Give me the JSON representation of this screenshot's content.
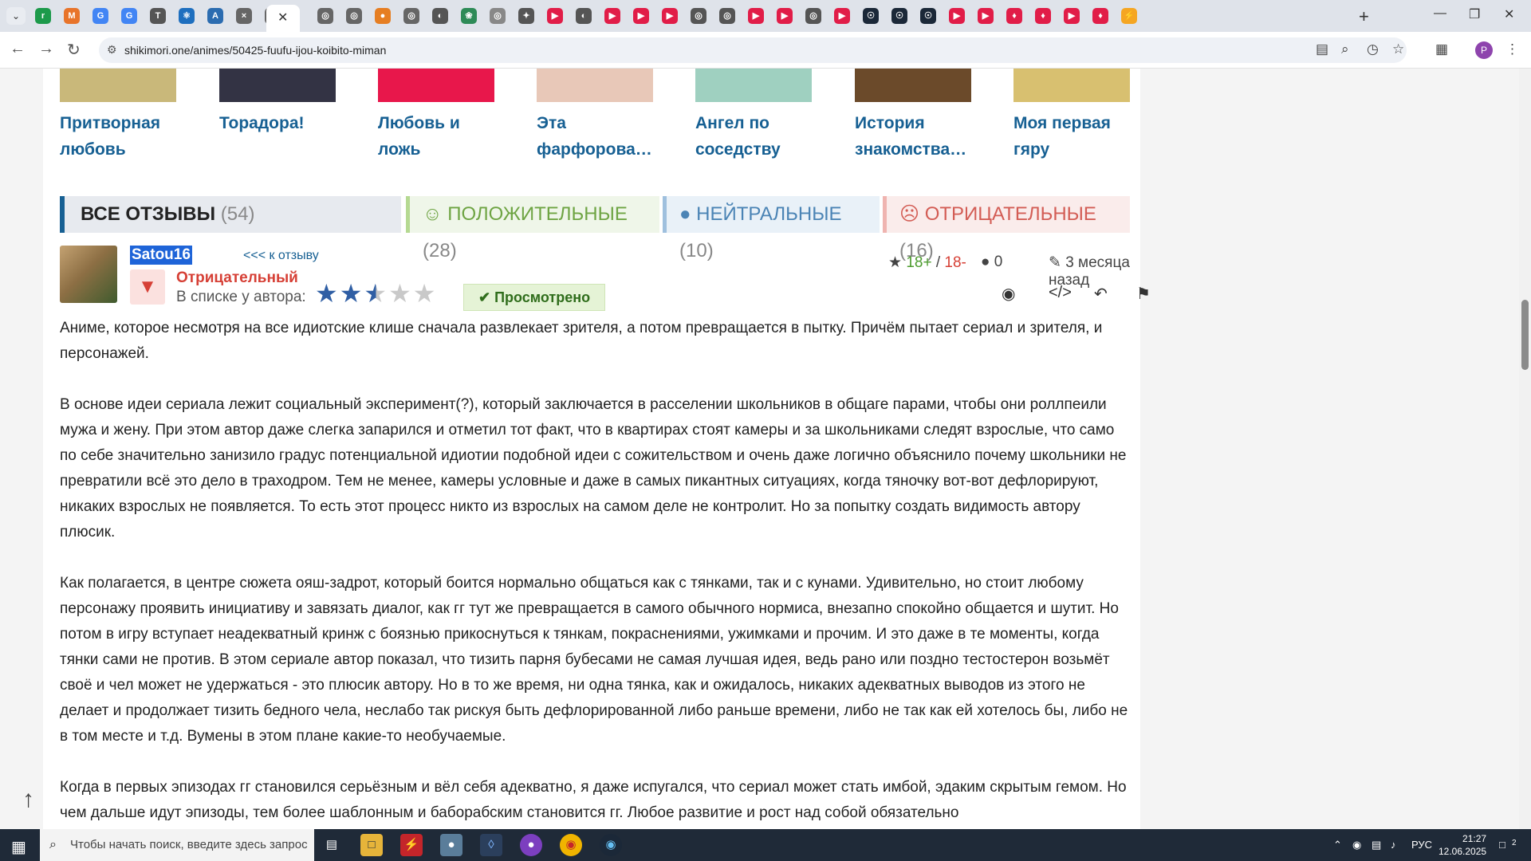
{
  "browser": {
    "tab_favicons": [
      "r",
      "M",
      "G",
      "G",
      "T",
      "⚛",
      "A",
      "×",
      "◎",
      "◎",
      "◎",
      "●",
      "◎",
      "◐",
      "❀",
      "◎",
      "✦",
      "▶",
      "◐",
      "▶",
      "▶",
      "▶",
      "◎",
      "◎",
      "▶",
      "▶",
      "◎",
      "▶",
      "☉",
      "☉",
      "☉",
      "▶",
      "▶",
      "♦",
      "♦",
      "▶",
      "♦",
      "⚡"
    ],
    "new_tab_label": "+",
    "url": "shikimori.one/animes/50425-fuufu-ijou-koibito-miman",
    "profile_initial": "P"
  },
  "similar_anime": [
    {
      "title": "Притворная любовь",
      "poster_color": "#c9b87a"
    },
    {
      "title": "Торадора!",
      "poster_color": "#333344"
    },
    {
      "title": "Любовь и ложь",
      "poster_color": "#e8174b"
    },
    {
      "title": "Эта фарфорова…",
      "poster_color": "#e8c8b8"
    },
    {
      "title": "Ангел по соседству",
      "poster_color": "#9fd0c0"
    },
    {
      "title": "История знакомства…",
      "poster_color": "#6b4a2a"
    },
    {
      "title": "Моя первая гяру",
      "poster_color": "#d8c070"
    }
  ],
  "review_tabs": {
    "all": {
      "label": "ВСЕ ОТЗЫВЫ",
      "count": "(54)"
    },
    "positive": {
      "label": "ПОЛОЖИТЕЛЬНЫЕ",
      "count": "(28)"
    },
    "neutral": {
      "label": "НЕЙТРАЛЬНЫЕ",
      "count": "(10)"
    },
    "negative": {
      "label": "ОТРИЦАТЕЛЬНЫЕ",
      "count": "(16)"
    }
  },
  "review": {
    "author": "Satou16",
    "back_link": "<<< к отзыву",
    "opinion": "Отрицательный",
    "in_list_label": "В списке у автора:",
    "rating": 2.5,
    "status": "Просмотрено",
    "age_plus": "18+",
    "age_separator": " / ",
    "age_minus": "18-",
    "comments": "0",
    "time_ago": "3 месяца назад",
    "paragraphs": [
      "Аниме, которое несмотря на все идиотские клише сначала развлекает зрителя, а потом превращается в пытку. Причём пытает сериал и зрителя, и персонажей.",
      "В основе идеи сериала лежит социальный эксперимент(?), который заключается в расселении школьников в общаге парами, чтобы они роллпеили мужа и жену. При этом автор даже слегка запарился и отметил тот факт, что в квартирах стоят камеры и за школьниками следят взрослые, что само по себе значительно занизило градус потенциальной идиотии подобной идеи с сожительством и очень даже логично объяснило почему школьники не превратили всё это дело в траходром. Тем не менее, камеры условные и даже в самых пикантных ситуациях, когда тяночку вот-вот дефлорируют, никаких взрослых не появляется. То есть этот процесс никто из взрослых на самом деле не контролит. Но за попытку создать видимость автору плюсик.",
      "Как полагается, в центре сюжета ояш-задрот, который боится нормально общаться как с тянками, так и с кунами. Удивительно, но стоит любому персонажу проявить инициативу и завязать диалог, как гг тут же превращается в самого обычного нормиса, внезапно спокойно общается и шутит. Но потом в игру вступает неадекватный кринж с боязнью прикоснуться к тянкам, покраснениями, ужимками и прочим. И это даже в те моменты, когда тянки сами не против. В этом сериале автор показал, что тизить парня бубесами не самая лучшая идея, ведь рано или поздно тестостерон возьмёт своё и чел может не удержаться - это плюсик автору. Но в то же время, ни одна тянка, как и ожидалось, никаких адекватных выводов из этого не делает и продолжает тизить бедного чела, неслабо так рискуя быть дефлорированной либо раньше времени, либо не так как ей хотелось бы, либо не в том месте и т.д. Вумены в этом плане какие-то необучаемые.",
      "Когда в первых эпизодах гг становился серьёзным и вёл себя адекватно, я даже испугался, что сериал может стать имбой, эдаким скрытым гемом. Но чем дальше идут эпизоды, тем более шаблонным и баборабским становится гг. Любое развитие и рост над собой обязательно"
    ]
  },
  "taskbar": {
    "search_placeholder": "Чтобы начать поиск, введите здесь запрос",
    "language": "РУС",
    "time": "21:27",
    "date": "12.06.2025",
    "notifications": "2"
  }
}
